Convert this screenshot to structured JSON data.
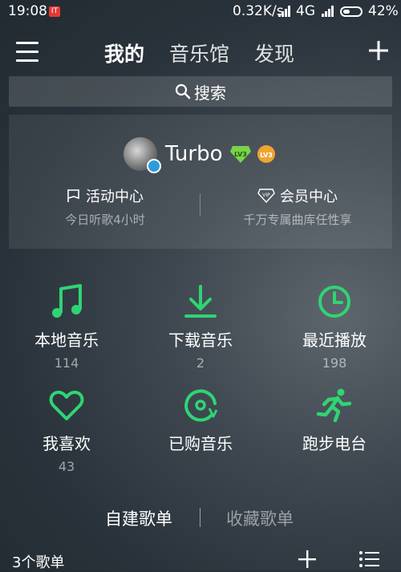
{
  "status_bar": {
    "time": "19:08",
    "app_badge": "IT",
    "speed": "0.32K/s",
    "network": "4G",
    "battery_percent": "42%",
    "battery_level": 0.42
  },
  "nav": {
    "tabs": [
      {
        "label": "我的",
        "active": true
      },
      {
        "label": "音乐馆",
        "active": false
      },
      {
        "label": "发现",
        "active": false
      }
    ]
  },
  "search": {
    "label": "搜索"
  },
  "profile": {
    "username": "Turbo",
    "level_badges": [
      "LV3",
      "LV3"
    ],
    "quick_links": [
      {
        "title": "活动中心",
        "subtitle": "今日听歌4小时",
        "icon": "flag-icon"
      },
      {
        "title": "会员中心",
        "subtitle": "千万专属曲库任性享",
        "icon": "vip-icon"
      }
    ]
  },
  "grid": [
    {
      "label": "本地音乐",
      "count": "114",
      "icon": "music-note-icon"
    },
    {
      "label": "下载音乐",
      "count": "2",
      "icon": "download-icon"
    },
    {
      "label": "最近播放",
      "count": "198",
      "icon": "clock-icon"
    },
    {
      "label": "我喜欢",
      "count": "43",
      "icon": "heart-icon"
    },
    {
      "label": "已购音乐",
      "count": "",
      "icon": "purchased-disc-icon"
    },
    {
      "label": "跑步电台",
      "count": "",
      "icon": "running-icon"
    }
  ],
  "playlist_tabs": [
    {
      "label": "自建歌单",
      "active": true
    },
    {
      "label": "收藏歌单",
      "active": false
    }
  ],
  "footer": {
    "count_label": "3个歌单"
  },
  "colors": {
    "accent": "#2ed573",
    "badge_red": "#e53935",
    "level_green": "#7bd34b",
    "level_orange": "#f0a431"
  }
}
